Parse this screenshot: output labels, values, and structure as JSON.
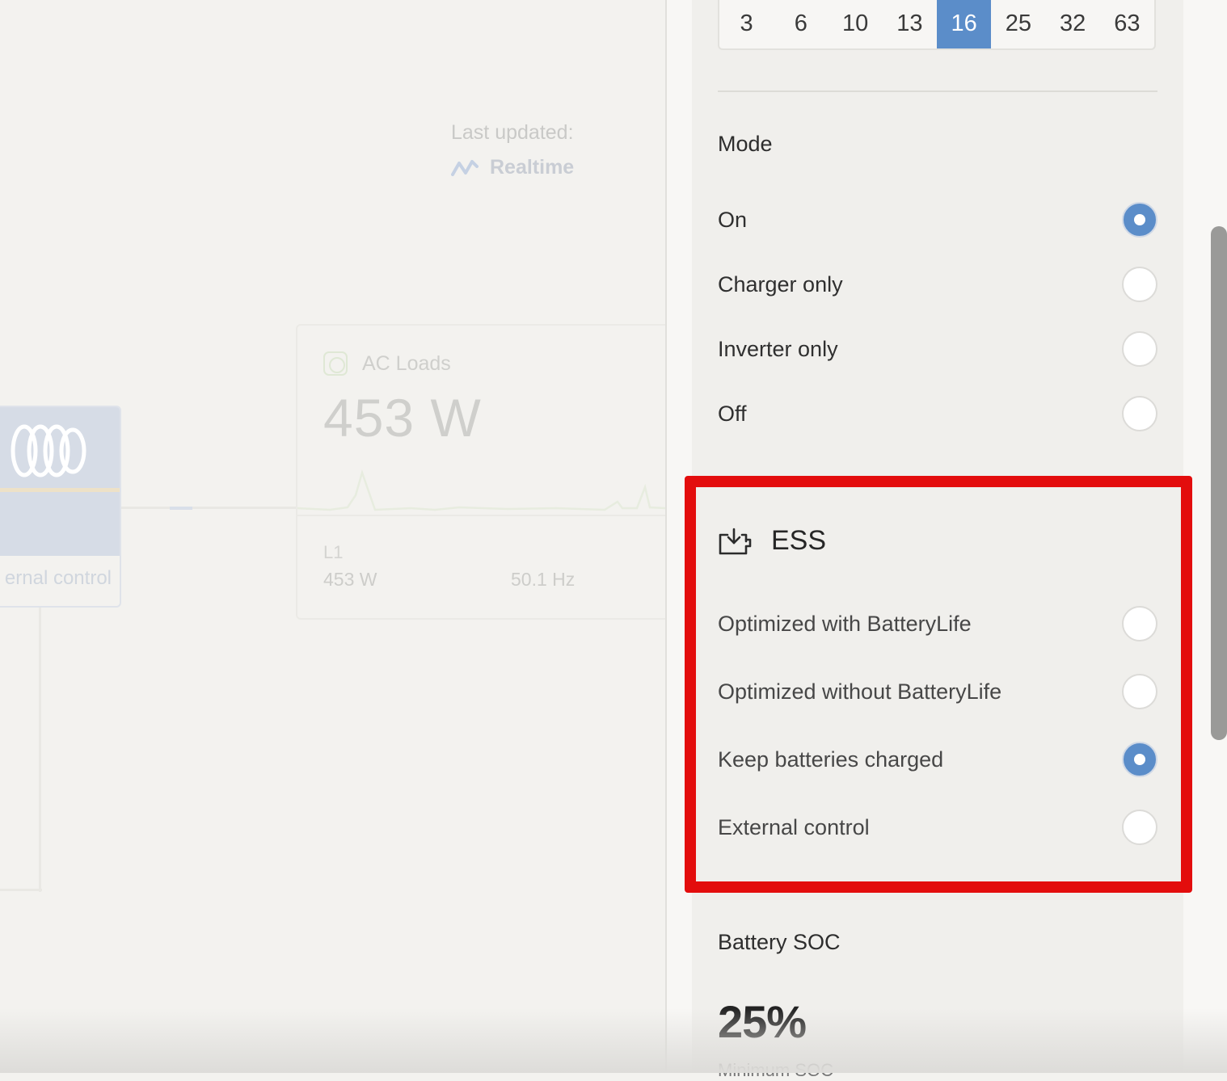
{
  "background": {
    "last_updated_label": "Last updated:",
    "realtime_label": "Realtime",
    "inverter": {
      "mode_text": "ernal control"
    },
    "ac_loads": {
      "title": "AC Loads",
      "value": "453 W",
      "phase_label": "L1",
      "phase_power": "453 W",
      "phase_frequency": "50.1 Hz"
    }
  },
  "panel": {
    "current_limit": {
      "options": [
        "3",
        "6",
        "10",
        "13",
        "16",
        "25",
        "32",
        "63"
      ],
      "selected": "16"
    },
    "mode": {
      "title": "Mode",
      "options": [
        "On",
        "Charger only",
        "Inverter only",
        "Off"
      ],
      "selected": "On"
    },
    "ess": {
      "title": "ESS",
      "icon": "battery-download-icon",
      "options": [
        "Optimized with BatteryLife",
        "Optimized without BatteryLife",
        "Keep batteries charged",
        "External control"
      ],
      "selected": "Keep batteries charged"
    },
    "battery_soc": {
      "title": "Battery SOC",
      "value": "25%",
      "subtitle": "Minimum SOC"
    }
  },
  "colors": {
    "accent": "#5b8dc9",
    "highlight": "#e30d0d"
  }
}
